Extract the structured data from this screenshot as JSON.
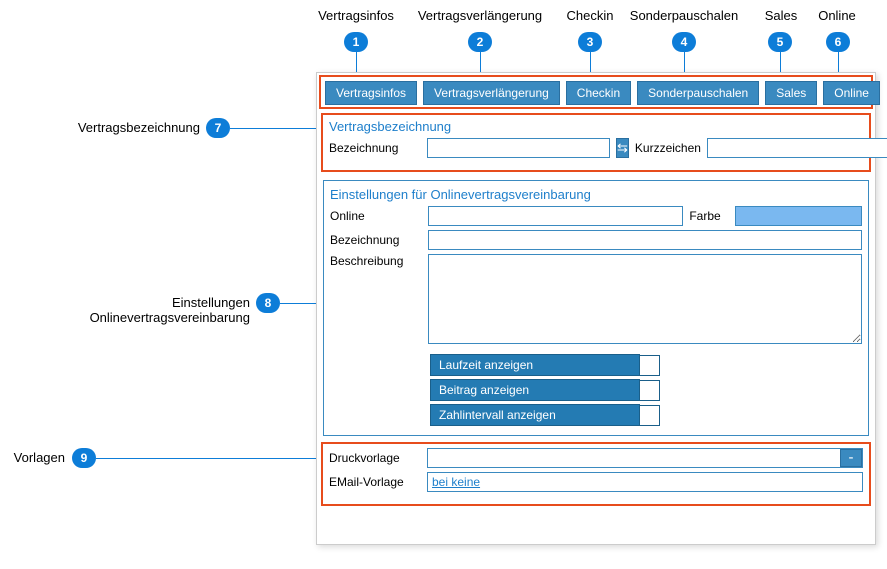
{
  "callouts": {
    "c1": {
      "num": "1",
      "label": "Vertragsinfos"
    },
    "c2": {
      "num": "2",
      "label": "Vertragsverlängerung"
    },
    "c3": {
      "num": "3",
      "label": "Checkin"
    },
    "c4": {
      "num": "4",
      "label": "Sonderpauschalen"
    },
    "c5": {
      "num": "5",
      "label": "Sales"
    },
    "c6": {
      "num": "6",
      "label": "Online"
    },
    "c7": {
      "num": "7",
      "label": "Vertragsbezeichnung"
    },
    "c8": {
      "num": "8",
      "label": "Einstellungen Onlinevertragsvereinbarung"
    },
    "c9": {
      "num": "9",
      "label": "Vorlagen"
    }
  },
  "tabs": {
    "t1": "Vertragsinfos",
    "t2": "Vertragsverlängerung",
    "t3": "Checkin",
    "t4": "Sonderpauschalen",
    "t5": "Sales",
    "t6": "Online"
  },
  "section1": {
    "title": "Vertragsbezeichnung",
    "bezeichnung_label": "Bezeichnung",
    "kurz_label": "Kurzzeichen",
    "swap_icon": "⇆"
  },
  "section2": {
    "title": "Einstellungen für Onlinevertragsvereinbarung",
    "online_label": "Online",
    "farbe_label": "Farbe",
    "bezeichnung_label": "Bezeichnung",
    "beschreibung_label": "Beschreibung",
    "toggles": {
      "t1": "Laufzeit anzeigen",
      "t2": "Beitrag anzeigen",
      "t3": "Zahlintervall anzeigen"
    }
  },
  "section3": {
    "druck_label": "Druckvorlage",
    "email_label": "EMail-Vorlage",
    "email_value": "bei keine",
    "dash": "-"
  }
}
